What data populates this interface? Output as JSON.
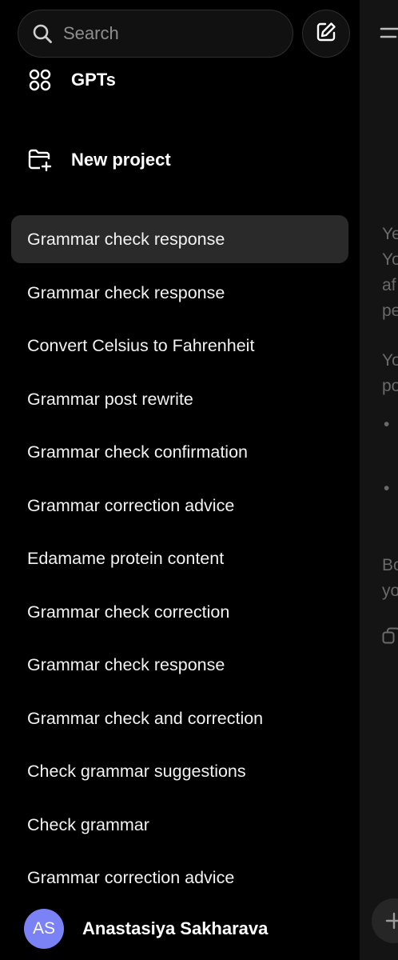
{
  "search": {
    "placeholder": "Search",
    "icon": "search-icon"
  },
  "new_chat": {
    "icon": "edit-icon"
  },
  "nav": {
    "gpts_label": "GPTs",
    "gpts_icon": "grid-icon",
    "new_project_label": "New project",
    "new_project_icon": "folder-plus-icon"
  },
  "history": [
    "Grammar check response",
    "Grammar check response",
    "Convert Celsius to Fahrenheit",
    "Grammar post rewrite",
    "Grammar check confirmation",
    "Grammar correction advice",
    "Edamame protein content",
    "Grammar check correction",
    "Grammar check response",
    "Grammar check and correction",
    "Check grammar suggestions",
    "Check grammar",
    "Grammar correction advice"
  ],
  "user": {
    "initials": "AS",
    "name": "Anastasiya Sakharava",
    "avatar_color": "#7b82f5"
  },
  "chat_panel": {
    "para1_line1": "Ye",
    "para1_line2": "Yo",
    "para1_line3": "af",
    "para1_line4": "pe",
    "para2_line1": "Yo",
    "para2_line2": "po",
    "bullet1": "•",
    "bullet2": "•",
    "para3_line1": "Bo",
    "para3_line2": "yo"
  },
  "colors": {
    "background": "#000000",
    "active_item": "#2a2a2a",
    "chat_panel": "#141414"
  }
}
